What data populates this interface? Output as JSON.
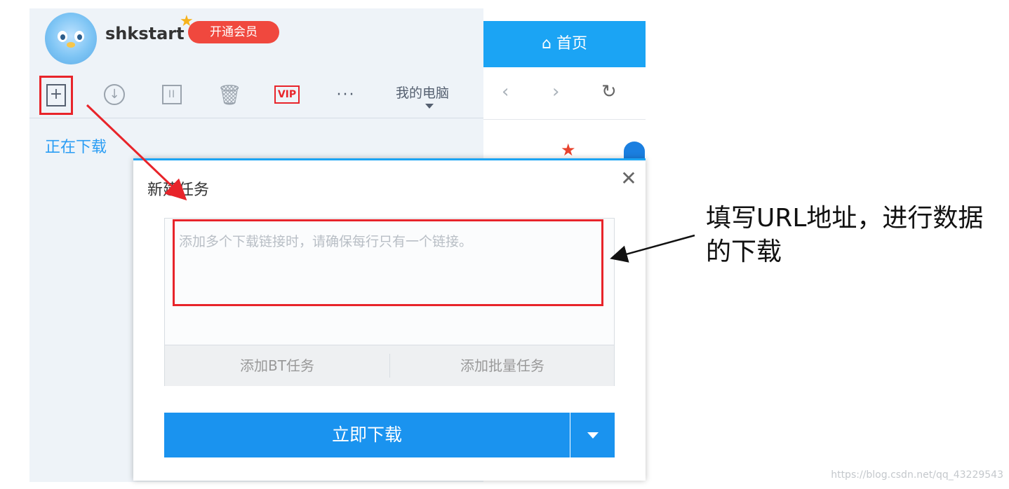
{
  "header": {
    "username": "shkstart",
    "vip_badge": "开通会员",
    "crown_glyph": "★"
  },
  "toolbar": {
    "new_task_glyph": "+",
    "download_glyph": "↓",
    "pause_glyph": "II",
    "delete_glyph": "🗑",
    "vip_label": "VIP",
    "more_glyph": "···",
    "my_computer": "我的电脑"
  },
  "sidebar": {
    "downloading": "正在下载"
  },
  "browser": {
    "home_tab": "⌂ 首页",
    "back_glyph": "‹",
    "forward_glyph": "›",
    "refresh_glyph": "↻"
  },
  "dialog": {
    "title": "新建任务",
    "close_glyph": "✕",
    "url_placeholder": "添加多个下载链接时，请确保每行只有一个链接。",
    "add_bt": "添加BT任务",
    "add_batch": "添加批量任务",
    "download_now": "立即下载"
  },
  "annotation": {
    "text": "填写URL地址，进行数据的下载"
  },
  "watermark": "https://blog.csdn.net/qq_43229543",
  "colors": {
    "accent": "#1ba4f4",
    "highlight": "#e8242a"
  }
}
